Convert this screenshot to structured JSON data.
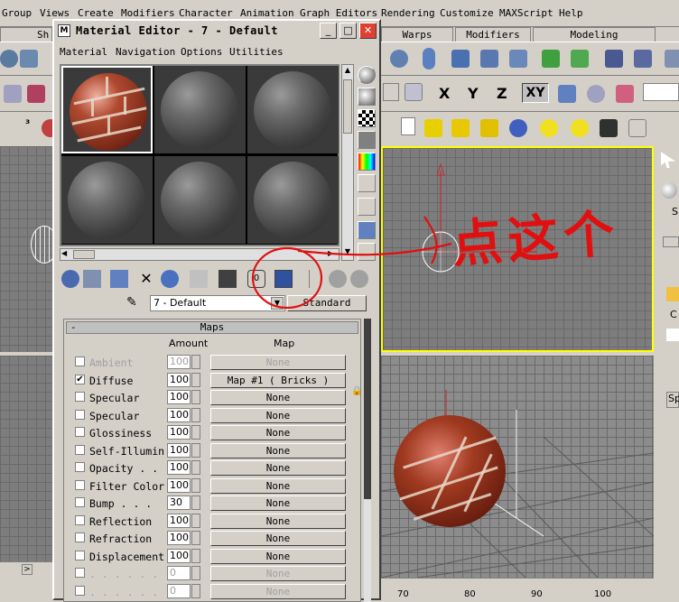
{
  "main_menu": [
    "Group",
    "Views",
    "Create",
    "Modifiers",
    "Character",
    "Animation",
    "Graph Editors",
    "Rendering",
    "Customize",
    "MAXScript",
    "Help"
  ],
  "command_tabs": [
    "Sh",
    "Warps",
    "Modifiers",
    "Modeling"
  ],
  "axis_buttons": [
    "X",
    "Y",
    "Z",
    "XY"
  ],
  "material_editor": {
    "title": "Material Editor - 7 - Default",
    "menu": [
      "Material",
      "Navigation",
      "Options",
      "Utilities"
    ],
    "material_name": "7 - Default",
    "type_button": "Standard",
    "rollout_title": "Maps",
    "columns": {
      "amount": "Amount",
      "map": "Map"
    },
    "maps": [
      {
        "name": "Ambient",
        "checked": false,
        "amount": "100",
        "map": "None",
        "dim": true
      },
      {
        "name": "Diffuse",
        "checked": true,
        "amount": "100",
        "map": "Map #1  ( Bricks )",
        "dim": false
      },
      {
        "name": "Specular",
        "checked": false,
        "amount": "100",
        "map": "None",
        "dim": false
      },
      {
        "name": "Specular",
        "checked": false,
        "amount": "100",
        "map": "None",
        "dim": false
      },
      {
        "name": "Glossiness",
        "checked": false,
        "amount": "100",
        "map": "None",
        "dim": false
      },
      {
        "name": "Self-Illumin",
        "checked": false,
        "amount": "100",
        "map": "None",
        "dim": false
      },
      {
        "name": "Opacity . .",
        "checked": false,
        "amount": "100",
        "map": "None",
        "dim": false
      },
      {
        "name": "Filter Color",
        "checked": false,
        "amount": "100",
        "map": "None",
        "dim": false
      },
      {
        "name": "Bump  . . .",
        "checked": false,
        "amount": "30",
        "map": "None",
        "dim": false
      },
      {
        "name": "Reflection",
        "checked": false,
        "amount": "100",
        "map": "None",
        "dim": false
      },
      {
        "name": "Refraction",
        "checked": false,
        "amount": "100",
        "map": "None",
        "dim": false
      },
      {
        "name": "Displacement",
        "checked": false,
        "amount": "100",
        "map": "None",
        "dim": false
      },
      {
        "name": ". . . . . .",
        "checked": false,
        "amount": "0",
        "map": "None",
        "dim": true
      },
      {
        "name": ". . . . . .",
        "checked": false,
        "amount": "0",
        "map": "None",
        "dim": true
      }
    ]
  },
  "annotation": {
    "text": "点这个",
    "color": "#e01010"
  },
  "ruler_ticks": [
    "70",
    "80",
    "90",
    "100"
  ],
  "right_panel_labels": [
    "S",
    "C",
    "Sp"
  ]
}
